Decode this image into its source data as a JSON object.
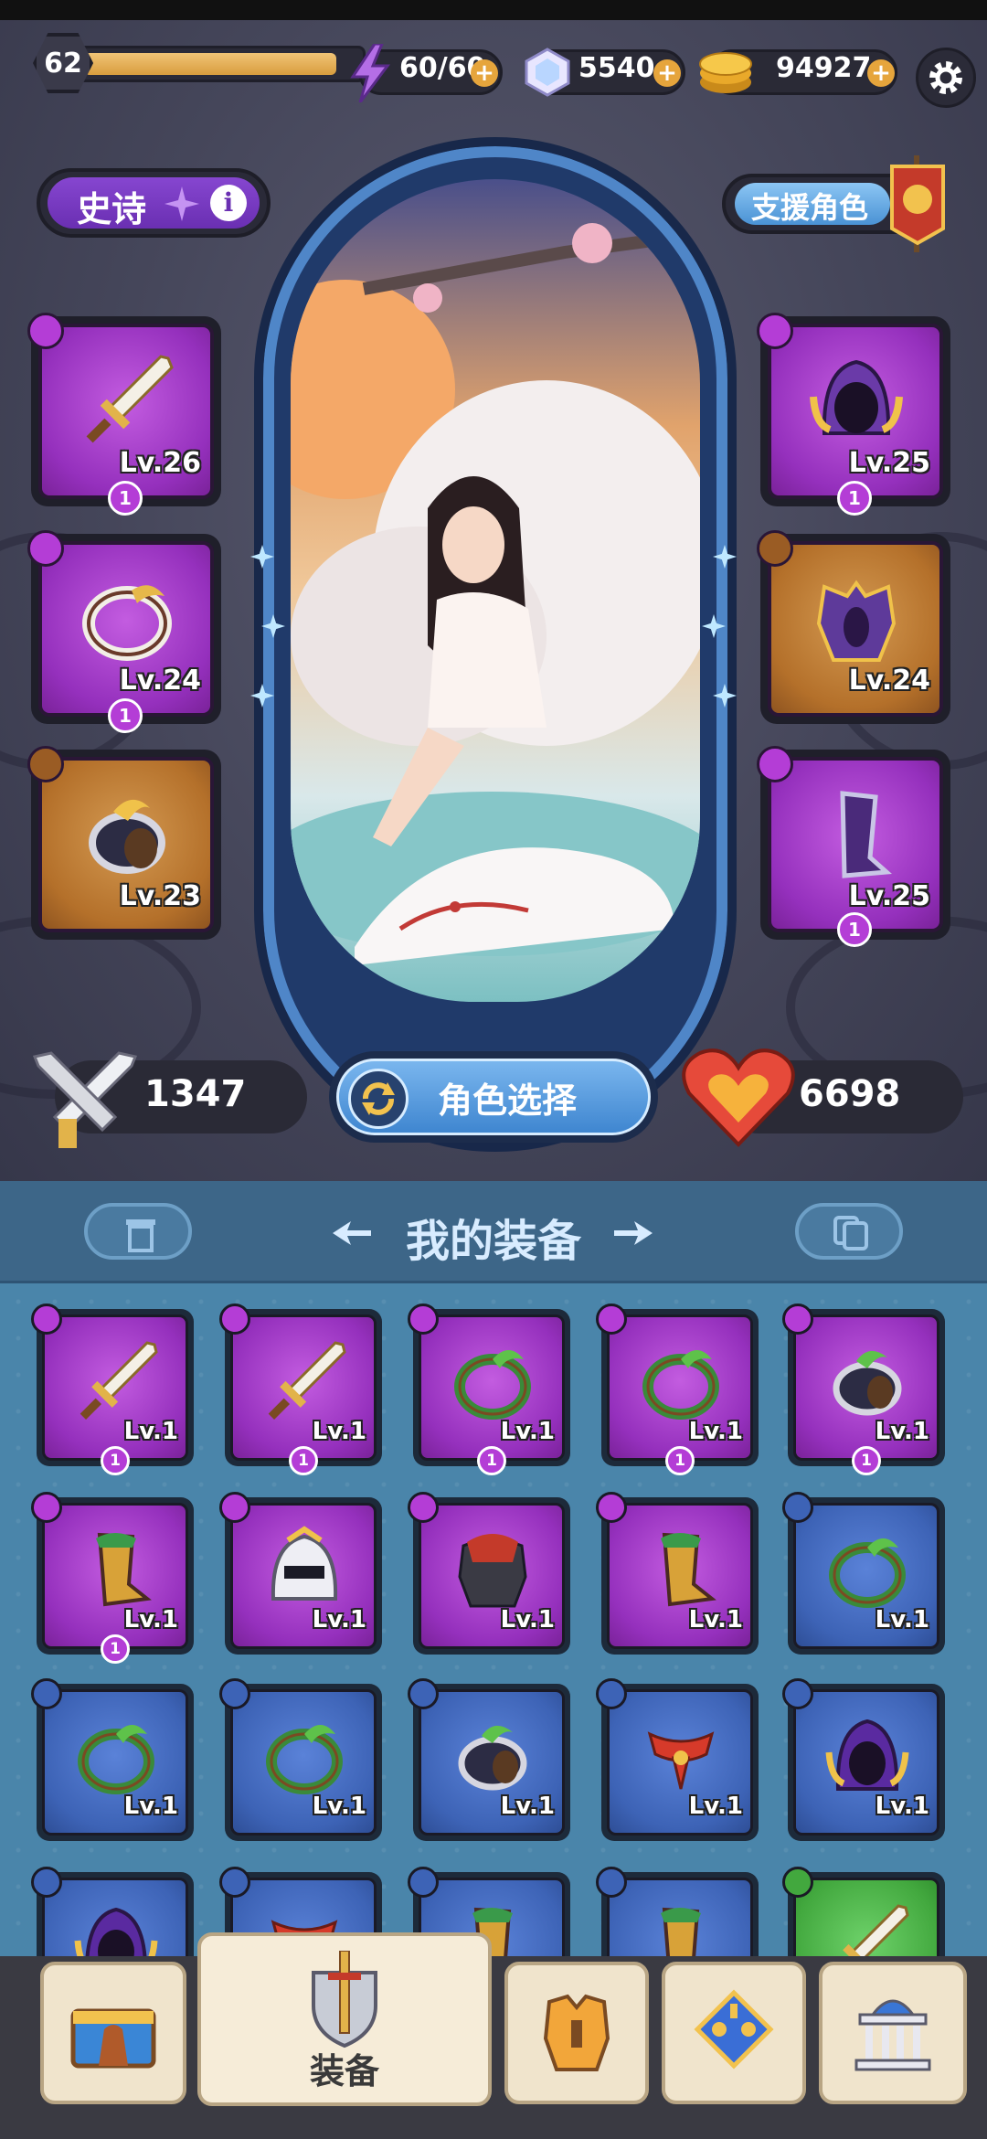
{
  "header": {
    "level": "62",
    "level_progress": 0.92,
    "energy": "60/60",
    "gems": "5540",
    "gold": "94927"
  },
  "rarity": {
    "label": "史诗"
  },
  "support": {
    "label": "支援角色"
  },
  "equipped": [
    {
      "slot": "weapon",
      "level": "Lv.26",
      "stars": "1",
      "rarity": "purple",
      "icon": "sword-icon"
    },
    {
      "slot": "ring",
      "level": "Lv.24",
      "stars": "1",
      "rarity": "purple",
      "icon": "ring-icon"
    },
    {
      "slot": "accessory",
      "level": "Lv.23",
      "stars": "",
      "rarity": "orange",
      "icon": "bracelet-icon"
    },
    {
      "slot": "helmet",
      "level": "Lv.25",
      "stars": "1",
      "rarity": "purple",
      "icon": "hood-icon"
    },
    {
      "slot": "armor",
      "level": "Lv.24",
      "stars": "",
      "rarity": "orange",
      "icon": "armor-icon"
    },
    {
      "slot": "boots",
      "level": "Lv.25",
      "stars": "1",
      "rarity": "purple",
      "icon": "boots-icon"
    }
  ],
  "stats": {
    "attack": "1347",
    "health": "6698"
  },
  "char_select": {
    "label": "角色选择"
  },
  "inventory": {
    "title": "我的装备",
    "items": [
      {
        "level": "Lv.1",
        "stars": "1",
        "rarity": "purple",
        "icon": "sword-icon"
      },
      {
        "level": "Lv.1",
        "stars": "1",
        "rarity": "purple",
        "icon": "sword-icon"
      },
      {
        "level": "Lv.1",
        "stars": "1",
        "rarity": "purple",
        "icon": "ring-icon"
      },
      {
        "level": "Lv.1",
        "stars": "1",
        "rarity": "purple",
        "icon": "ring-icon"
      },
      {
        "level": "Lv.1",
        "stars": "1",
        "rarity": "purple",
        "icon": "bracelet-icon"
      },
      {
        "level": "Lv.1",
        "stars": "1",
        "rarity": "purple",
        "icon": "boots-icon"
      },
      {
        "level": "Lv.1",
        "stars": "",
        "rarity": "purple",
        "icon": "helmet-icon"
      },
      {
        "level": "Lv.1",
        "stars": "",
        "rarity": "purple",
        "icon": "armor-icon"
      },
      {
        "level": "Lv.1",
        "stars": "",
        "rarity": "purple",
        "icon": "boots-icon"
      },
      {
        "level": "Lv.1",
        "stars": "",
        "rarity": "blue",
        "icon": "ring-icon"
      },
      {
        "level": "Lv.1",
        "stars": "",
        "rarity": "blue",
        "icon": "ring-icon"
      },
      {
        "level": "Lv.1",
        "stars": "",
        "rarity": "blue",
        "icon": "ring-icon"
      },
      {
        "level": "Lv.1",
        "stars": "",
        "rarity": "blue",
        "icon": "bracelet-icon"
      },
      {
        "level": "Lv.1",
        "stars": "",
        "rarity": "blue",
        "icon": "scarf-icon"
      },
      {
        "level": "Lv.1",
        "stars": "",
        "rarity": "blue",
        "icon": "hood-icon"
      },
      {
        "level": "",
        "stars": "",
        "rarity": "blue",
        "icon": "hood-icon"
      },
      {
        "level": "",
        "stars": "",
        "rarity": "blue",
        "icon": "scarf-icon"
      },
      {
        "level": "",
        "stars": "",
        "rarity": "blue",
        "icon": "boots-icon"
      },
      {
        "level": "",
        "stars": "",
        "rarity": "blue",
        "icon": "boots-icon"
      },
      {
        "level": "",
        "stars": "",
        "rarity": "green",
        "icon": "sword-icon"
      }
    ]
  },
  "nav": [
    {
      "label": "",
      "icon": "treasure-chest-icon"
    },
    {
      "label": "装备",
      "icon": "shield-sword-icon"
    },
    {
      "label": "",
      "icon": "armor-icon"
    },
    {
      "label": "",
      "icon": "skill-tree-icon"
    },
    {
      "label": "",
      "icon": "building-icon"
    }
  ],
  "colors": {
    "purple": "#9530bd",
    "orange": "#b4702a",
    "blue": "#3d63b6",
    "green": "#42a83e",
    "gold": "#e6a53c"
  }
}
